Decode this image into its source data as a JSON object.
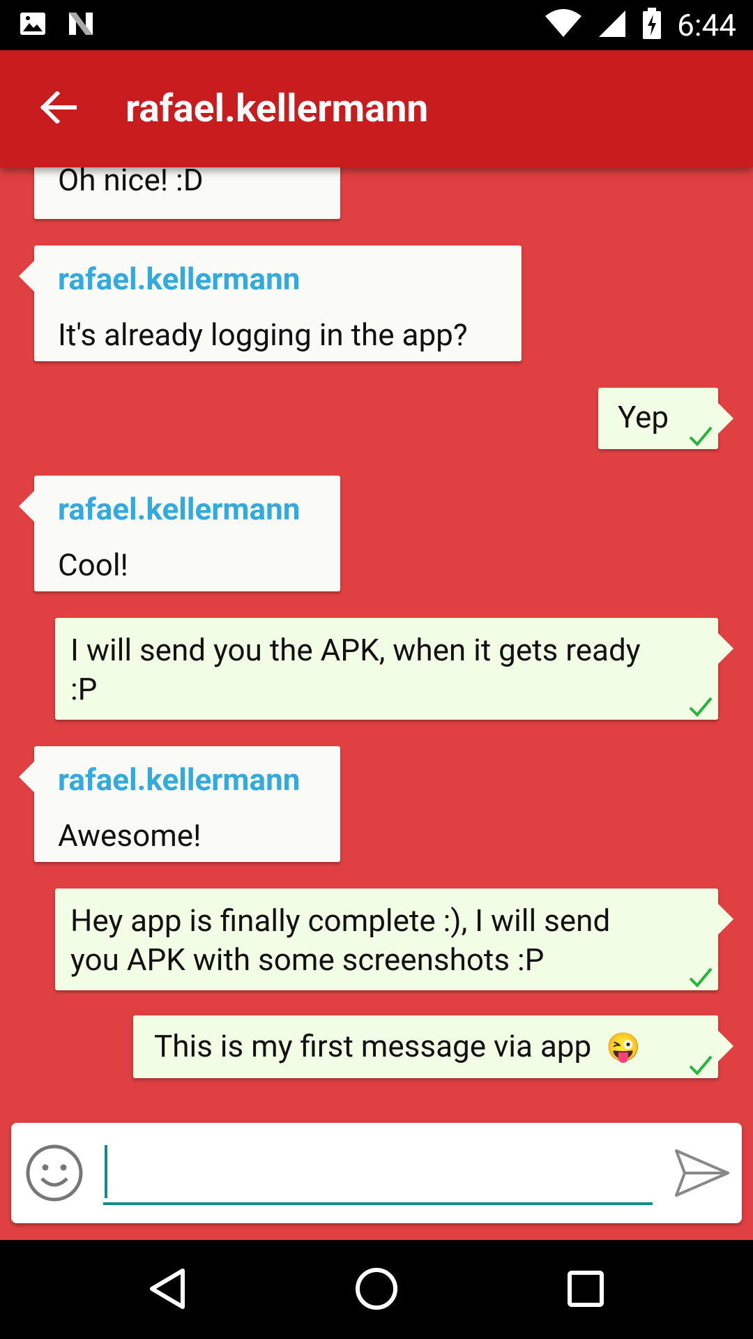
{
  "status_bar": {
    "time": "6:44",
    "icons": [
      "image-icon",
      "n-logo-icon",
      "wifi-icon",
      "cellular-signal-icon",
      "battery-charging-icon"
    ]
  },
  "app_bar": {
    "title": "rafael.kellermann",
    "back_icon": "arrow-left-icon",
    "color": "#c91c1e"
  },
  "chat": {
    "background": "#e04042",
    "messages": [
      {
        "direction": "in",
        "sender": "",
        "text": "Oh nice! :D"
      },
      {
        "direction": "in",
        "sender": "rafael.kellermann",
        "text": "It's already logging in the app?"
      },
      {
        "direction": "out",
        "text": "Yep",
        "status": "check-icon"
      },
      {
        "direction": "in",
        "sender": "rafael.kellermann",
        "text": "Cool!"
      },
      {
        "direction": "out",
        "text": "I will send you the APK, when it gets ready :P",
        "status": "check-icon"
      },
      {
        "direction": "in",
        "sender": "rafael.kellermann",
        "text": "Awesome!"
      },
      {
        "direction": "out",
        "text": "Hey app is finally complete :), I will send you APK with some screenshots :P",
        "status": "check-icon"
      },
      {
        "direction": "out",
        "text": "This is my first message via app",
        "emoji": "😜",
        "status": "check-icon"
      }
    ]
  },
  "composer": {
    "value": "",
    "emoji_icon": "smiley-icon",
    "send_icon": "send-icon",
    "accent": "#0f8f84"
  },
  "nav_bar": {
    "icons": [
      "back-triangle-icon",
      "home-circle-icon",
      "recents-square-icon"
    ]
  }
}
